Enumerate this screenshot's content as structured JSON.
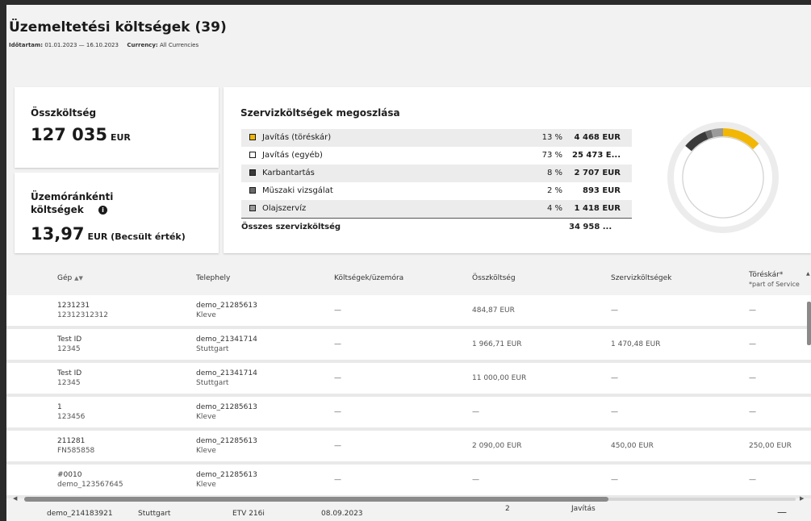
{
  "header": {
    "title": "Üzemeltetési költségek (39)",
    "period_label": "Időtartam:",
    "period_value": "01.01.2023 — 16.10.2023",
    "currency_label": "Currency:",
    "currency_value": "All Currencies"
  },
  "total_card": {
    "label": "Összköltség",
    "value": "127 035",
    "unit": "EUR"
  },
  "hourly_card": {
    "label_line1": "Üzemóránkénti",
    "label_line2": "költségek",
    "value": "13,97",
    "unit": "EUR (Becsült érték)"
  },
  "distribution": {
    "title": "Szervizköltségek megoszlása",
    "rows": [
      {
        "name": "Javítás (töréskár)",
        "percent": "13 %",
        "amount": "4 468 EUR",
        "color": "#f2b705"
      },
      {
        "name": "Javítás (egyéb)",
        "percent": "73 %",
        "amount": "25 473 E...",
        "color": "#ffffff"
      },
      {
        "name": "Karbantartás",
        "percent": "8 %",
        "amount": "2 707 EUR",
        "color": "#3a3a3a"
      },
      {
        "name": "Müszaki vizsgálat",
        "percent": "2 %",
        "amount": "893 EUR",
        "color": "#6a6a6a"
      },
      {
        "name": "Olajszervíz",
        "percent": "4 %",
        "amount": "1 418 EUR",
        "color": "#9a9a9a"
      }
    ],
    "total_label": "Összes szervizköltség",
    "total_amount": "34 958 ..."
  },
  "chart_data": {
    "type": "pie",
    "categories": [
      "Javítás (töréskár)",
      "Javítás (egyéb)",
      "Karbantartás",
      "Müszaki vizsgálat",
      "Olajszervíz"
    ],
    "values": [
      13,
      73,
      8,
      2,
      4
    ],
    "colors": [
      "#f2b705",
      "#ffffff",
      "#3a3a3a",
      "#6a6a6a",
      "#9a9a9a"
    ]
  },
  "table": {
    "columns": {
      "machine": "Gép",
      "site": "Telephely",
      "cost_per_hour": "Költségek/üzemóra",
      "total": "Összköltség",
      "service": "Szervizköltségek",
      "breakage": "Töréskár*",
      "breakage_note": "*part of Service"
    },
    "rows": [
      {
        "id": "1231231",
        "serial": "12312312312",
        "site": "demo_21285613",
        "city": "Kleve",
        "cph": "—",
        "total": "484,87 EUR",
        "service": "—",
        "breakage": "—"
      },
      {
        "id": "Test ID",
        "serial": "12345",
        "site": "demo_21341714",
        "city": "Stuttgart",
        "cph": "—",
        "total": "1 966,71 EUR",
        "service": "1 470,48 EUR",
        "breakage": "—"
      },
      {
        "id": "Test ID",
        "serial": "12345",
        "site": "demo_21341714",
        "city": "Stuttgart",
        "cph": "—",
        "total": "11 000,00 EUR",
        "service": "—",
        "breakage": "—"
      },
      {
        "id": "1",
        "serial": "123456",
        "site": "demo_21285613",
        "city": "Kleve",
        "cph": "—",
        "total": "—",
        "service": "—",
        "breakage": "—"
      },
      {
        "id": "211281",
        "serial": "FN585858",
        "site": "demo_21285613",
        "city": "Kleve",
        "cph": "—",
        "total": "2 090,00 EUR",
        "service": "450,00 EUR",
        "breakage": "250,00 EUR"
      },
      {
        "id": "#0010",
        "serial": "demo_123567645",
        "site": "demo_21285613",
        "city": "Kleve",
        "cph": "—",
        "total": "—",
        "service": "—",
        "breakage": "—"
      }
    ]
  },
  "below_row": {
    "site": "demo_214183921",
    "city": "Stuttgart",
    "model": "ETV 216i",
    "date": "08.09.2023",
    "count": "2",
    "type": "Javítás"
  }
}
